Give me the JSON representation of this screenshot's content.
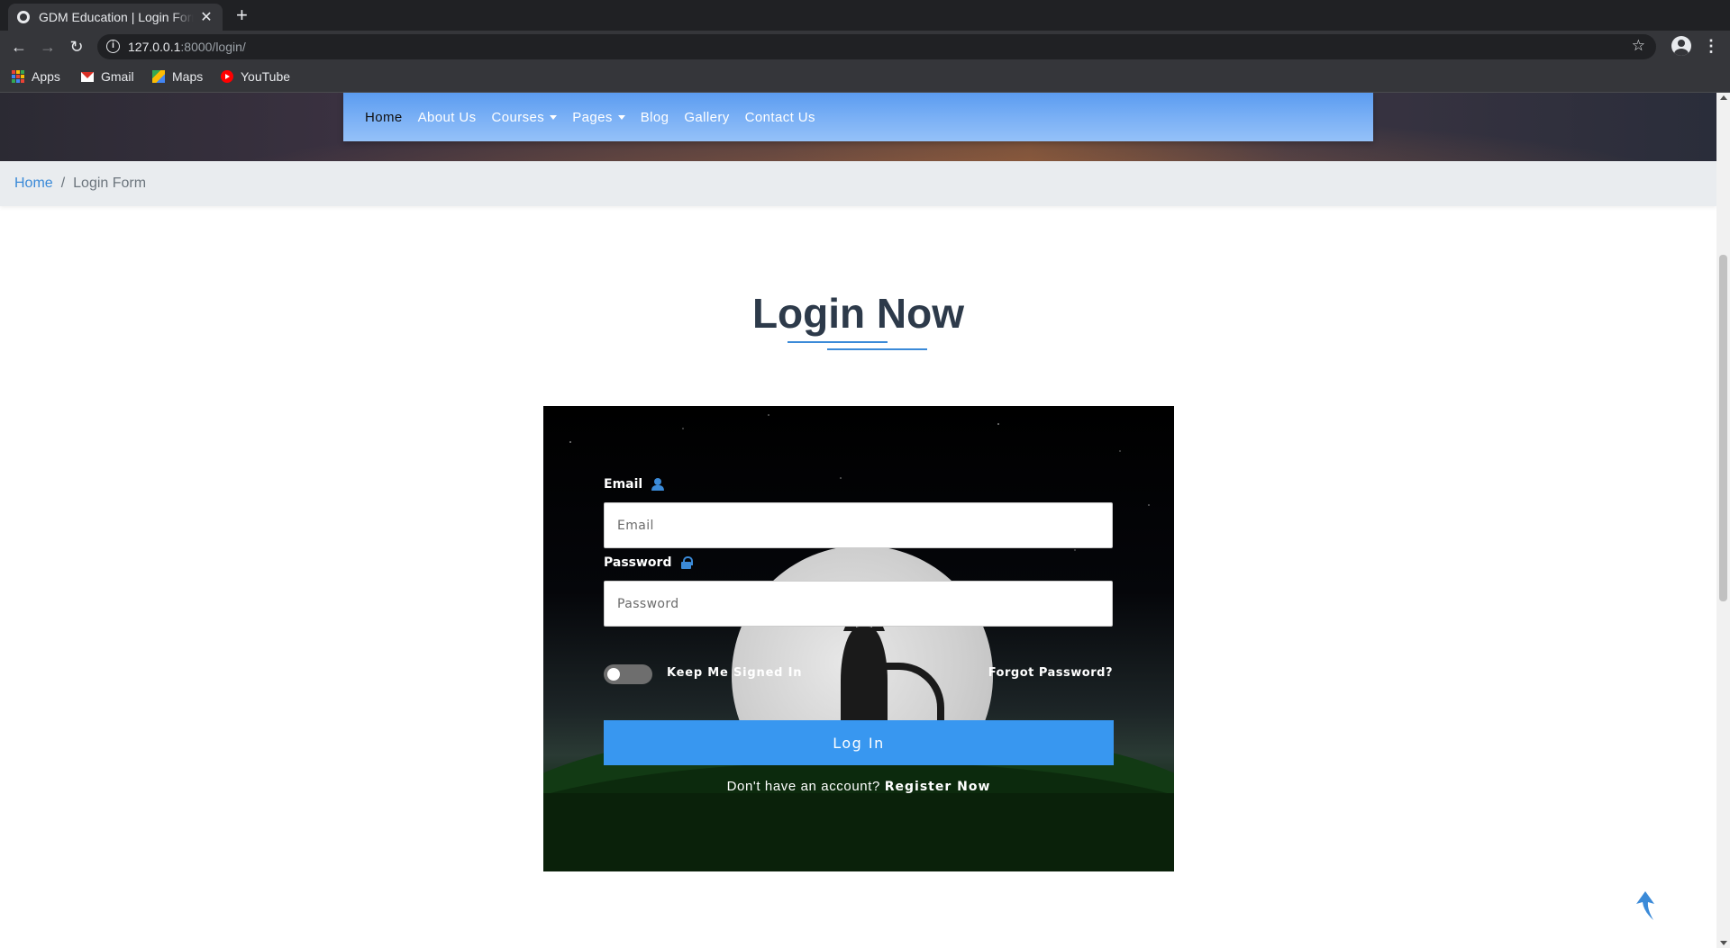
{
  "browser": {
    "tab_title": "GDM Education | Login Form",
    "close_glyph": "✕",
    "new_tab_glyph": "+",
    "url_host": "127.0.0.1",
    "url_rest": ":8000/login/",
    "bookmarks": [
      "Apps",
      "Gmail",
      "Maps",
      "YouTube"
    ]
  },
  "nav": {
    "items": [
      "Home",
      "About Us",
      "Courses",
      "Pages",
      "Blog",
      "Gallery",
      "Contact Us"
    ],
    "active": "Home",
    "accent": "#5b9cf0"
  },
  "breadcrumb": {
    "home": "Home",
    "separator": "/",
    "current": "Login Form"
  },
  "heading": {
    "light": "Login",
    "bold": "Now"
  },
  "form": {
    "email_label": "Email",
    "email_placeholder": "Email",
    "email_value": "",
    "password_label": "Password",
    "password_placeholder": "Password",
    "password_value": "",
    "keep_signed_in": "Keep Me Signed In",
    "keep_signed_in_checked": false,
    "forgot": "Forgot Password?",
    "submit": "Log In",
    "submit_color": "#3897f0",
    "no_account": "Don't have an account?",
    "register": "Register Now"
  },
  "icons": {
    "email": "user-icon",
    "password": "lock-icon",
    "back_to_top": "arrow-up-icon"
  }
}
